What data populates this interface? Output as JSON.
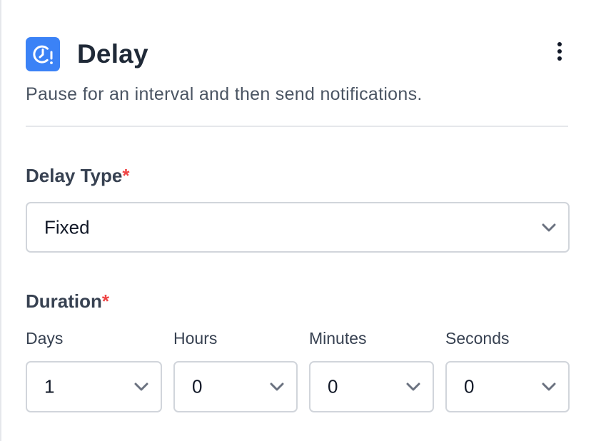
{
  "header": {
    "title": "Delay",
    "description": "Pause for an interval and then send notifications.",
    "icon": "clock-alert-icon",
    "more_icon": "more-vertical-icon",
    "accent_color": "#3b82f6"
  },
  "delay_type": {
    "label": "Delay Type",
    "required_mark": "*",
    "selected": "Fixed"
  },
  "duration": {
    "label": "Duration",
    "required_mark": "*",
    "units": [
      {
        "label": "Days",
        "selected": "1"
      },
      {
        "label": "Hours",
        "selected": "0"
      },
      {
        "label": "Minutes",
        "selected": "0"
      },
      {
        "label": "Seconds",
        "selected": "0"
      }
    ]
  },
  "colors": {
    "required": "#ef4444",
    "border": "#d1d5db",
    "divider": "#e5e7eb"
  }
}
